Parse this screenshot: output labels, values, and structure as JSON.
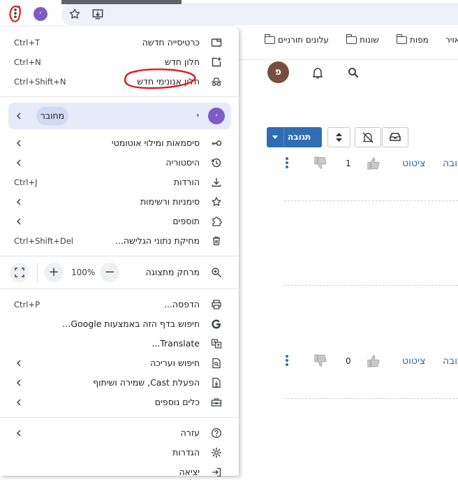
{
  "browser": {
    "profile_initial": "י",
    "profile_color": "#7e5cc6"
  },
  "page": {
    "bookmarks": [
      {
        "label": "אויר"
      },
      {
        "label": "מפות"
      },
      {
        "label": "שונות"
      },
      {
        "label": "עלונים תורניים"
      }
    ],
    "user_avatar_letter": "פ",
    "reply_button_label": "תגובה",
    "posts": [
      {
        "reply_link": "תגובה",
        "quote_link": "ציטוט",
        "like_count": "1"
      },
      {
        "reply_link": "תגובה",
        "quote_link": "ציטוט",
        "like_count": "0"
      }
    ],
    "accent_color": "#2f6db5"
  },
  "menu": {
    "group1": [
      {
        "label": "כרטיסייה חדשה",
        "shortcut": "Ctrl+T",
        "icon": "new-tab-icon"
      },
      {
        "label": "חלון חדש",
        "shortcut": "Ctrl+N",
        "icon": "new-window-icon"
      },
      {
        "label": "חלון אנונימי חדש",
        "shortcut": "Ctrl+Shift+N",
        "icon": "incognito-icon"
      }
    ],
    "profile": {
      "name": "י",
      "status": "מחובר"
    },
    "group2": [
      {
        "label": "סיסמאות ומילוי אוטומטי",
        "shortcut": "",
        "icon": "key-icon"
      },
      {
        "label": "היסטוריה",
        "shortcut": "",
        "icon": "history-icon"
      },
      {
        "label": "הורדות",
        "shortcut": "Ctrl+J",
        "icon": "download-icon"
      },
      {
        "label": "סימניות ורשימות",
        "shortcut": "",
        "icon": "star-icon"
      },
      {
        "label": "תוספים",
        "shortcut": "",
        "icon": "extension-icon"
      },
      {
        "label": "מחיקת נתוני הגלישה...",
        "shortcut": "Ctrl+Shift+Del",
        "icon": "trash-icon"
      }
    ],
    "zoom": {
      "label": "מרחק מתצוגה",
      "value": "100%",
      "minus": "−",
      "plus": "+"
    },
    "group3": [
      {
        "label": "הדפסה...",
        "shortcut": "Ctrl+P",
        "icon": "print-icon"
      },
      {
        "label": "חיפוש בדף הזה באמצעות Google...",
        "shortcut": "",
        "icon": "google-icon"
      },
      {
        "label": "Translate...",
        "shortcut": "",
        "icon": "translate-icon"
      },
      {
        "label": "חיפוש ועריכה",
        "shortcut": "",
        "icon": "find-icon"
      },
      {
        "label": "הפעלת Cast, שמירה ושיתוף",
        "shortcut": "",
        "icon": "cast-save-icon"
      },
      {
        "label": "כלים נוספים",
        "shortcut": "",
        "icon": "toolbox-icon"
      }
    ],
    "group4": [
      {
        "label": "עזרה",
        "shortcut": "",
        "icon": "help-icon"
      },
      {
        "label": "הגדרות",
        "shortcut": "",
        "icon": "settings-icon"
      },
      {
        "label": "יציאה",
        "shortcut": "",
        "icon": "exit-icon"
      }
    ]
  }
}
